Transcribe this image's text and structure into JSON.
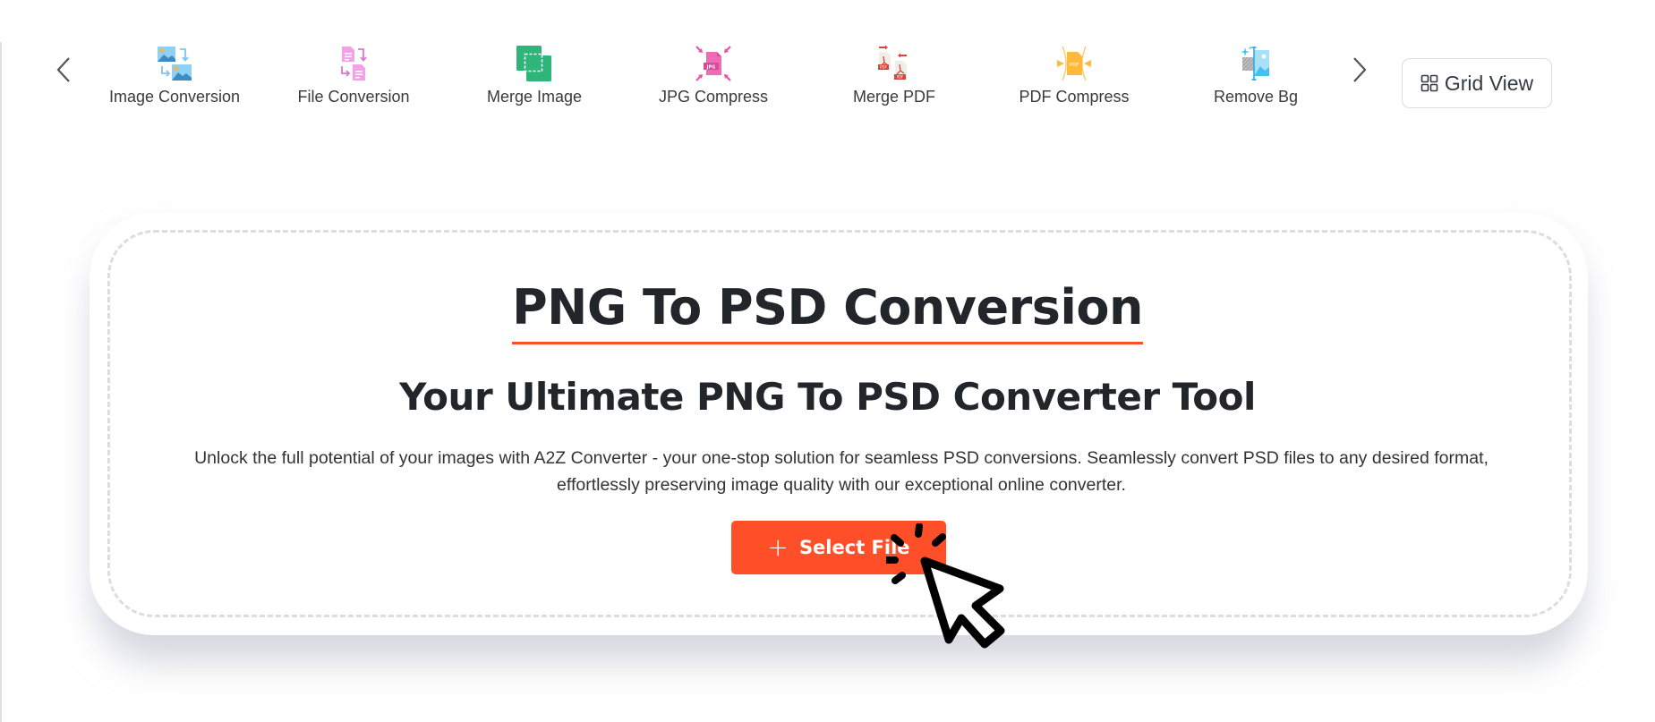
{
  "toolbar": {
    "prev_icon": "chevron-left-icon",
    "next_icon": "chevron-right-icon",
    "tools": [
      {
        "label": "Image Conversion",
        "icon": "image-conversion-icon",
        "color": "#5bb5f0"
      },
      {
        "label": "File Conversion",
        "icon": "file-conversion-icon",
        "color": "#e87fd8"
      },
      {
        "label": "Merge Image",
        "icon": "merge-image-icon",
        "color": "#2db57a"
      },
      {
        "label": "JPG Compress",
        "icon": "jpg-compress-icon",
        "color": "#ea4fa6"
      },
      {
        "label": "Merge PDF",
        "icon": "merge-pdf-icon",
        "color": "#d9443f"
      },
      {
        "label": "PDF Compress",
        "icon": "pdf-compress-icon",
        "color": "#ffba3b"
      },
      {
        "label": "Remove Bg",
        "icon": "remove-bg-icon",
        "color": "#49bff0"
      }
    ],
    "grid_view": {
      "label": "Grid View",
      "icon": "grid-icon"
    }
  },
  "hero": {
    "title": "PNG To PSD Conversion",
    "subtitle": "Your Ultimate PNG To PSD Converter Tool",
    "description": "Unlock the full potential of your images with A2Z Converter - your one-stop solution for seamless PSD conversions. Seamlessly convert PSD files to any desired format, effortlessly preserving image quality with our exceptional online converter.",
    "select_button": {
      "label": "Select File",
      "icon": "plus-icon"
    }
  },
  "colors": {
    "accent": "#ff4f28",
    "heading": "#22252a",
    "dashed_border": "#dddddd"
  },
  "overlay": {
    "cursor_icon": "click-cursor-icon"
  }
}
